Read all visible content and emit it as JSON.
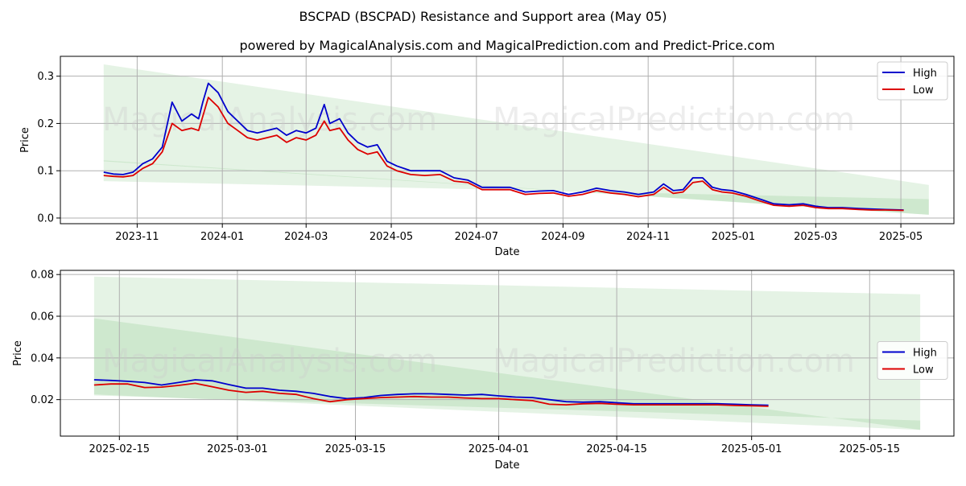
{
  "title": "BSCPAD (BSCPAD) Resistance and Support area (May 05)",
  "subtitle": "powered by MagicalAnalysis.com and MagicalPrediction.com and Predict-Price.com",
  "watermark": [
    "MagicalAnalysis.com",
    "MagicalPrediction.com"
  ],
  "colors": {
    "high": "#0000cc",
    "low": "#dd0000",
    "band": "#2ca02c",
    "grid": "#b0b0b0"
  },
  "chart_data": [
    {
      "type": "line",
      "xlabel": "Date",
      "ylabel": "Price",
      "xlim": [
        "2023-09-07",
        "2025-06-08"
      ],
      "ylim": [
        -0.012,
        0.342
      ],
      "xticks": [
        "2023-11",
        "2024-01",
        "2024-03",
        "2024-05",
        "2024-07",
        "2024-09",
        "2024-11",
        "2025-01",
        "2025-03",
        "2025-05"
      ],
      "xtick_dates": [
        "2023-11-01",
        "2024-01-01",
        "2024-03-01",
        "2024-05-01",
        "2024-07-01",
        "2024-09-01",
        "2024-11-01",
        "2025-01-01",
        "2025-03-01",
        "2025-05-01"
      ],
      "yticks": [
        0.0,
        0.1,
        0.2,
        0.3
      ],
      "ytick_labels": [
        "0.0",
        "0.1",
        "0.2",
        "0.3"
      ],
      "grid": true,
      "legend": "top-right",
      "bands": [
        {
          "x": [
            "2023-10-08",
            "2025-05-21"
          ],
          "upper": [
            0.325,
            0.07
          ],
          "lower": [
            0.12,
            0.007
          ]
        },
        {
          "x": [
            "2023-10-08",
            "2025-05-21"
          ],
          "upper": [
            0.122,
            0.007
          ],
          "lower": [
            0.078,
            0.04
          ]
        }
      ],
      "series": [
        {
          "name": "High",
          "x": [
            "2023-10-08",
            "2023-10-15",
            "2023-10-22",
            "2023-10-29",
            "2023-11-05",
            "2023-11-12",
            "2023-11-19",
            "2023-11-26",
            "2023-12-03",
            "2023-12-10",
            "2023-12-15",
            "2023-12-18",
            "2023-12-22",
            "2023-12-29",
            "2024-01-05",
            "2024-01-12",
            "2024-01-19",
            "2024-01-26",
            "2024-02-02",
            "2024-02-09",
            "2024-02-16",
            "2024-02-23",
            "2024-03-01",
            "2024-03-08",
            "2024-03-14",
            "2024-03-18",
            "2024-03-25",
            "2024-03-31",
            "2024-04-07",
            "2024-04-14",
            "2024-04-21",
            "2024-04-28",
            "2024-05-05",
            "2024-05-15",
            "2024-05-25",
            "2024-06-05",
            "2024-06-15",
            "2024-06-25",
            "2024-07-05",
            "2024-07-15",
            "2024-07-25",
            "2024-08-05",
            "2024-08-15",
            "2024-08-25",
            "2024-09-05",
            "2024-09-15",
            "2024-09-25",
            "2024-10-05",
            "2024-10-15",
            "2024-10-25",
            "2024-11-05",
            "2024-11-12",
            "2024-11-19",
            "2024-11-26",
            "2024-12-03",
            "2024-12-10",
            "2024-12-17",
            "2024-12-24",
            "2024-12-31",
            "2025-01-10",
            "2025-01-20",
            "2025-01-30",
            "2025-02-10",
            "2025-02-20",
            "2025-03-01",
            "2025-03-10",
            "2025-03-20",
            "2025-04-01",
            "2025-04-10",
            "2025-04-20",
            "2025-05-03"
          ],
          "values": [
            0.097,
            0.093,
            0.092,
            0.097,
            0.115,
            0.125,
            0.15,
            0.245,
            0.205,
            0.22,
            0.21,
            0.245,
            0.285,
            0.265,
            0.225,
            0.205,
            0.185,
            0.18,
            0.185,
            0.19,
            0.175,
            0.185,
            0.18,
            0.19,
            0.24,
            0.2,
            0.21,
            0.18,
            0.16,
            0.15,
            0.155,
            0.12,
            0.11,
            0.1,
            0.1,
            0.1,
            0.085,
            0.08,
            0.065,
            0.065,
            0.065,
            0.055,
            0.057,
            0.058,
            0.05,
            0.055,
            0.063,
            0.058,
            0.055,
            0.05,
            0.055,
            0.072,
            0.058,
            0.06,
            0.085,
            0.085,
            0.065,
            0.06,
            0.058,
            0.05,
            0.04,
            0.03,
            0.028,
            0.03,
            0.025,
            0.022,
            0.022,
            0.02,
            0.019,
            0.018,
            0.017
          ]
        },
        {
          "name": "Low",
          "x": [
            "2023-10-08",
            "2023-10-15",
            "2023-10-22",
            "2023-10-29",
            "2023-11-05",
            "2023-11-12",
            "2023-11-19",
            "2023-11-26",
            "2023-12-03",
            "2023-12-10",
            "2023-12-15",
            "2023-12-18",
            "2023-12-22",
            "2023-12-29",
            "2024-01-05",
            "2024-01-12",
            "2024-01-19",
            "2024-01-26",
            "2024-02-02",
            "2024-02-09",
            "2024-02-16",
            "2024-02-23",
            "2024-03-01",
            "2024-03-08",
            "2024-03-14",
            "2024-03-18",
            "2024-03-25",
            "2024-03-31",
            "2024-04-07",
            "2024-04-14",
            "2024-04-21",
            "2024-04-28",
            "2024-05-05",
            "2024-05-15",
            "2024-05-25",
            "2024-06-05",
            "2024-06-15",
            "2024-06-25",
            "2024-07-05",
            "2024-07-15",
            "2024-07-25",
            "2024-08-05",
            "2024-08-15",
            "2024-08-25",
            "2024-09-05",
            "2024-09-15",
            "2024-09-25",
            "2024-10-05",
            "2024-10-15",
            "2024-10-25",
            "2024-11-05",
            "2024-11-12",
            "2024-11-19",
            "2024-11-26",
            "2024-12-03",
            "2024-12-10",
            "2024-12-17",
            "2024-12-24",
            "2024-12-31",
            "2025-01-10",
            "2025-01-20",
            "2025-01-30",
            "2025-02-10",
            "2025-02-20",
            "2025-03-01",
            "2025-03-10",
            "2025-03-20",
            "2025-04-01",
            "2025-04-10",
            "2025-04-20",
            "2025-05-03"
          ],
          "values": [
            0.09,
            0.088,
            0.087,
            0.09,
            0.105,
            0.115,
            0.14,
            0.2,
            0.185,
            0.19,
            0.185,
            0.215,
            0.255,
            0.235,
            0.2,
            0.185,
            0.17,
            0.165,
            0.17,
            0.175,
            0.16,
            0.17,
            0.165,
            0.175,
            0.205,
            0.185,
            0.19,
            0.165,
            0.145,
            0.135,
            0.14,
            0.11,
            0.1,
            0.092,
            0.09,
            0.092,
            0.078,
            0.075,
            0.06,
            0.06,
            0.06,
            0.05,
            0.052,
            0.053,
            0.046,
            0.05,
            0.058,
            0.053,
            0.05,
            0.045,
            0.05,
            0.065,
            0.052,
            0.055,
            0.075,
            0.078,
            0.06,
            0.055,
            0.053,
            0.046,
            0.036,
            0.027,
            0.025,
            0.027,
            0.022,
            0.02,
            0.02,
            0.018,
            0.017,
            0.017,
            0.016
          ]
        }
      ]
    },
    {
      "type": "line",
      "xlabel": "Date",
      "ylabel": "Price",
      "xlim": [
        "2025-02-08",
        "2025-05-25"
      ],
      "ylim": [
        0.0025,
        0.082
      ],
      "xticks": [
        "2025-02-15",
        "2025-03-01",
        "2025-03-15",
        "2025-04-01",
        "2025-04-15",
        "2025-05-01",
        "2025-05-15"
      ],
      "yticks": [
        0.02,
        0.04,
        0.06,
        0.08
      ],
      "ytick_labels": [
        "0.02",
        "0.04",
        "0.06",
        "0.08"
      ],
      "grid": true,
      "legend": "center-right",
      "bands": [
        {
          "x": [
            "2025-02-12",
            "2025-05-21"
          ],
          "upper": [
            0.079,
            0.0705
          ],
          "lower": [
            0.0225,
            0.0055
          ]
        },
        {
          "x": [
            "2025-02-12",
            "2025-05-21"
          ],
          "upper": [
            0.059,
            0.0055
          ],
          "lower": [
            0.022,
            0.01
          ]
        }
      ],
      "series": [
        {
          "name": "High",
          "x": [
            "2025-02-12",
            "2025-02-14",
            "2025-02-16",
            "2025-02-18",
            "2025-02-20",
            "2025-02-22",
            "2025-02-24",
            "2025-02-26",
            "2025-02-28",
            "2025-03-02",
            "2025-03-04",
            "2025-03-06",
            "2025-03-08",
            "2025-03-10",
            "2025-03-12",
            "2025-03-14",
            "2025-03-16",
            "2025-03-18",
            "2025-03-20",
            "2025-03-22",
            "2025-03-24",
            "2025-03-26",
            "2025-03-28",
            "2025-03-30",
            "2025-04-01",
            "2025-04-03",
            "2025-04-05",
            "2025-04-07",
            "2025-04-09",
            "2025-04-11",
            "2025-04-13",
            "2025-04-15",
            "2025-04-17",
            "2025-04-19",
            "2025-04-21",
            "2025-04-23",
            "2025-04-25",
            "2025-04-27",
            "2025-04-29",
            "2025-05-01",
            "2025-05-03"
          ],
          "values": [
            0.0295,
            0.0292,
            0.0288,
            0.0282,
            0.027,
            0.0282,
            0.0295,
            0.029,
            0.0272,
            0.0255,
            0.0255,
            0.0245,
            0.024,
            0.023,
            0.0215,
            0.0205,
            0.021,
            0.022,
            0.0225,
            0.0228,
            0.0228,
            0.0225,
            0.0222,
            0.0225,
            0.0218,
            0.0212,
            0.021,
            0.02,
            0.019,
            0.0188,
            0.019,
            0.0185,
            0.018,
            0.018,
            0.018,
            0.018,
            0.018,
            0.018,
            0.0178,
            0.0175,
            0.0173
          ]
        },
        {
          "name": "Low",
          "x": [
            "2025-02-12",
            "2025-02-14",
            "2025-02-16",
            "2025-02-18",
            "2025-02-20",
            "2025-02-22",
            "2025-02-24",
            "2025-02-26",
            "2025-02-28",
            "2025-03-02",
            "2025-03-04",
            "2025-03-06",
            "2025-03-08",
            "2025-03-10",
            "2025-03-12",
            "2025-03-14",
            "2025-03-16",
            "2025-03-18",
            "2025-03-20",
            "2025-03-22",
            "2025-03-24",
            "2025-03-26",
            "2025-03-28",
            "2025-03-30",
            "2025-04-01",
            "2025-04-03",
            "2025-04-05",
            "2025-04-07",
            "2025-04-09",
            "2025-04-11",
            "2025-04-13",
            "2025-04-15",
            "2025-04-17",
            "2025-04-19",
            "2025-04-21",
            "2025-04-23",
            "2025-04-25",
            "2025-04-27",
            "2025-04-29",
            "2025-05-01",
            "2025-05-03"
          ],
          "values": [
            0.027,
            0.0275,
            0.0275,
            0.0258,
            0.026,
            0.0268,
            0.0278,
            0.0262,
            0.0245,
            0.0235,
            0.024,
            0.023,
            0.0225,
            0.0205,
            0.019,
            0.02,
            0.0205,
            0.021,
            0.0212,
            0.0215,
            0.0212,
            0.0212,
            0.0208,
            0.0205,
            0.0205,
            0.02,
            0.0195,
            0.0178,
            0.0175,
            0.018,
            0.0182,
            0.0178,
            0.0175,
            0.0175,
            0.0175,
            0.0175,
            0.0175,
            0.0175,
            0.0172,
            0.017,
            0.0168
          ]
        }
      ]
    }
  ]
}
